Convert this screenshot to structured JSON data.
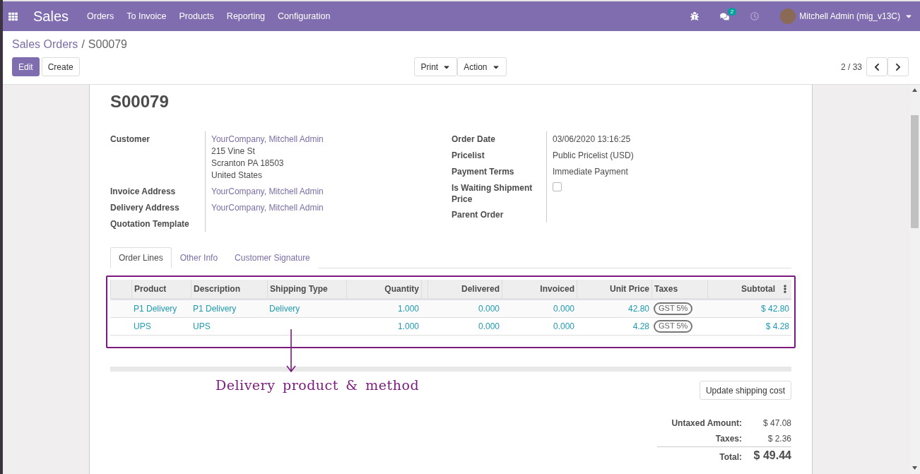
{
  "navbar": {
    "app": "Sales",
    "menu": [
      "Orders",
      "To Invoice",
      "Products",
      "Reporting",
      "Configuration"
    ],
    "message_count": "2",
    "user": "Mitchell Admin (mig_v13C)"
  },
  "breadcrumb": {
    "parent": "Sales Orders",
    "separator": "/",
    "current": "S00079"
  },
  "buttons": {
    "edit": "Edit",
    "create": "Create",
    "print": "Print",
    "action": "Action"
  },
  "pager": "2 / 33",
  "order": {
    "name": "S00079",
    "left_fields": [
      {
        "label": "Customer",
        "lines": [
          {
            "text": "YourCompany, Mitchell Admin",
            "kind": "link"
          },
          {
            "text": "215 Vine St",
            "kind": "plain"
          },
          {
            "text": "Scranton PA 18503",
            "kind": "plain"
          },
          {
            "text": "United States",
            "kind": "plain"
          }
        ]
      },
      {
        "label": "Invoice Address",
        "lines": [
          {
            "text": "YourCompany, Mitchell Admin",
            "kind": "link"
          }
        ]
      },
      {
        "label": "Delivery Address",
        "lines": [
          {
            "text": "YourCompany, Mitchell Admin",
            "kind": "link"
          }
        ]
      },
      {
        "label": "Quotation Template"
      }
    ],
    "right_fields": [
      {
        "label": "Order Date",
        "kind": "text",
        "value": "03/06/2020 13:16:25"
      },
      {
        "label": "Pricelist",
        "kind": "text",
        "value": "Public Pricelist (USD)"
      },
      {
        "label": "Payment Terms",
        "kind": "text",
        "value": "Immediate Payment"
      },
      {
        "label": "Is Waiting Shipment Price",
        "kind": "checkbox",
        "checked": false
      },
      {
        "label": "Parent Order",
        "kind": "text"
      }
    ]
  },
  "tabs": [
    {
      "label": "Order Lines",
      "selected": true
    },
    {
      "label": "Other Info",
      "selected": false
    },
    {
      "label": "Customer Signature",
      "selected": false
    }
  ],
  "table": {
    "columns": [
      "Product",
      "Description",
      "Shipping Type",
      "Quantity",
      "Delivered",
      "Invoiced",
      "Unit Price",
      "Taxes",
      "Subtotal"
    ],
    "rows": [
      {
        "product": "P1 Delivery",
        "description": "P1 Delivery",
        "shipping_type": "Delivery",
        "quantity": "1.000",
        "delivered": "0.000",
        "invoiced": "0.000",
        "unit_price": "42.80",
        "taxes": [
          "GST 5%"
        ],
        "subtotal": "$ 42.80"
      },
      {
        "product": "UPS",
        "description": "UPS",
        "quantity": "1.000",
        "delivered": "0.000",
        "invoiced": "0.000",
        "unit_price": "4.28",
        "taxes": [
          "GST 5%"
        ],
        "subtotal": "$ 4.28"
      }
    ]
  },
  "annotation": "Delivery product & method",
  "update_button": "Update shipping cost",
  "totals": [
    {
      "label": "Untaxed Amount:",
      "value": "$ 47.08",
      "kind": "normal"
    },
    {
      "label": "Taxes:",
      "value": "$ 2.36",
      "kind": "normal"
    },
    {
      "label": "Total:",
      "value": "$ 49.44",
      "kind": "grand"
    }
  ]
}
